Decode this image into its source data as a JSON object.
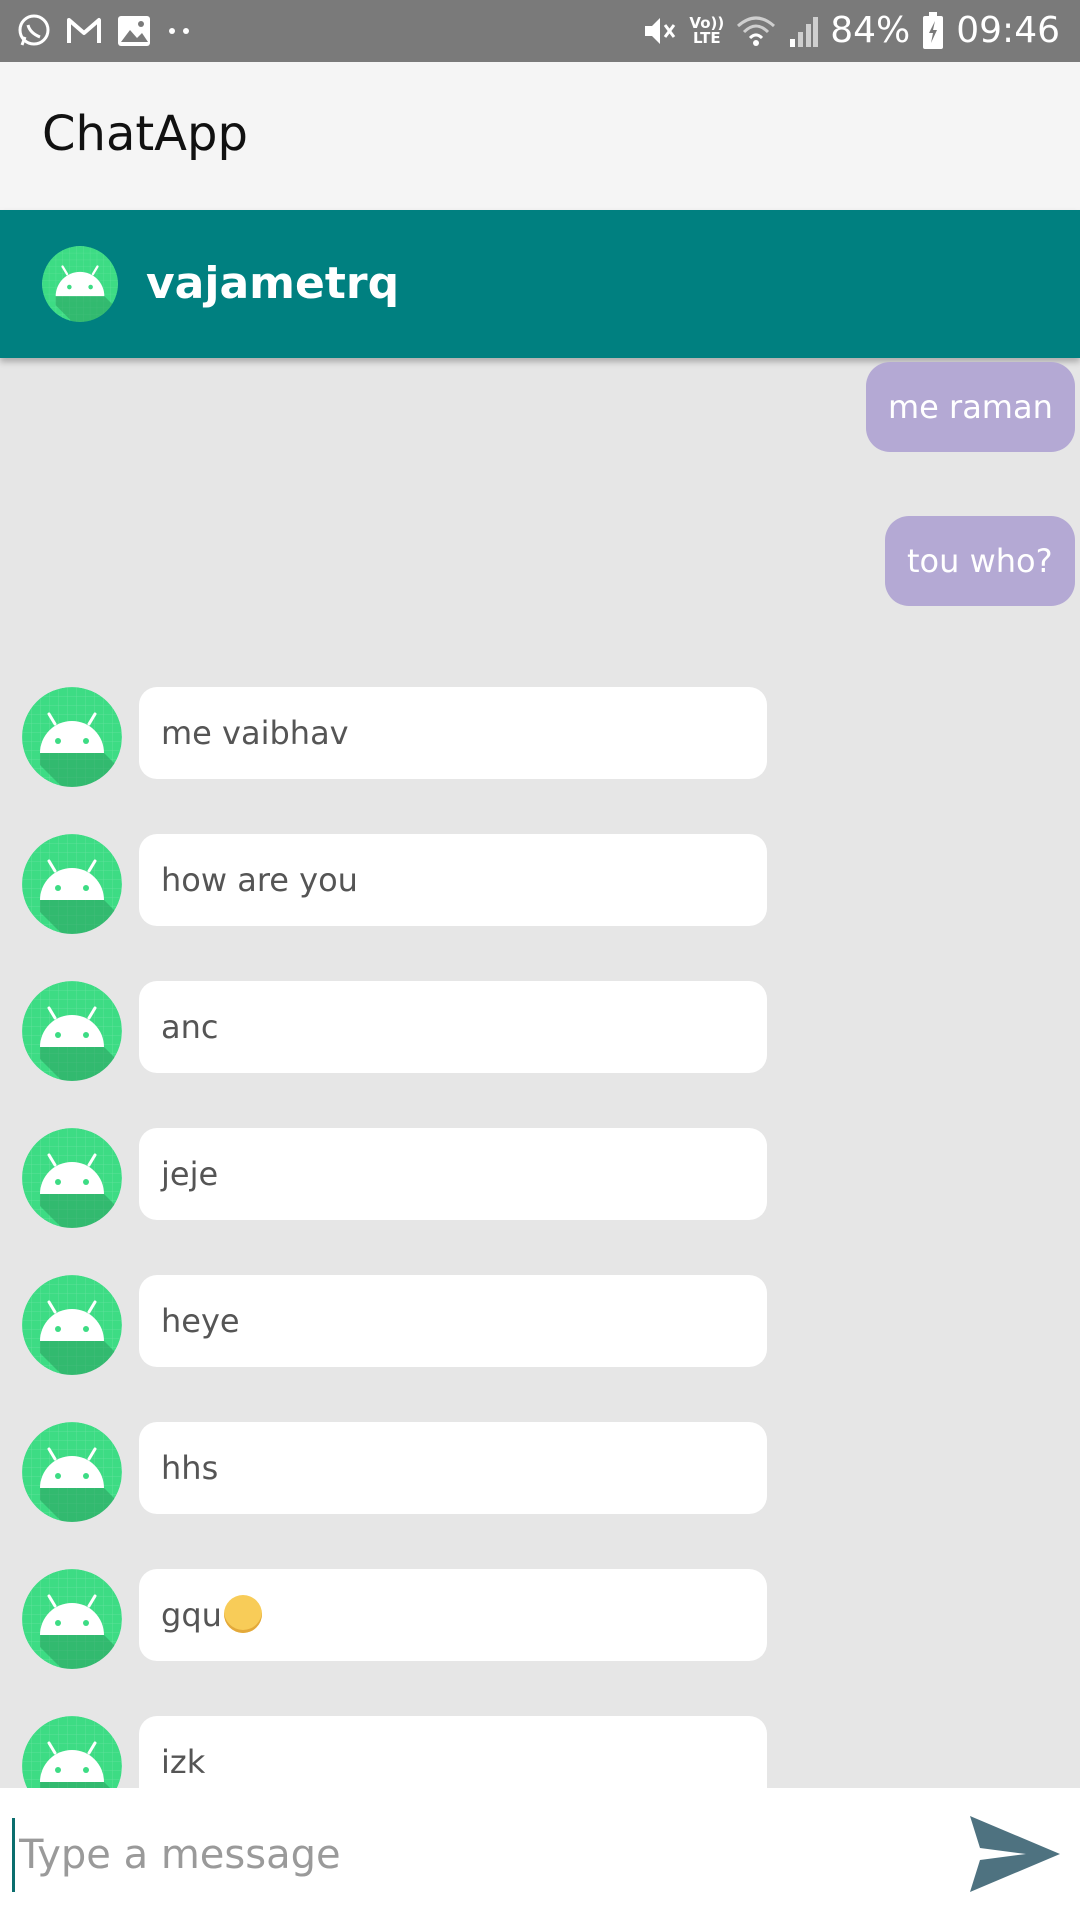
{
  "status_bar": {
    "icons_left": [
      "whatsapp-icon",
      "gmail-icon",
      "gallery-icon",
      "more-dots-icon"
    ],
    "icons_right": [
      "mute-icon",
      "volte-icon",
      "wifi-icon",
      "signal-icon",
      "battery-icon"
    ],
    "volte_top": "Vo))",
    "volte_bottom": "LTE",
    "battery": "84%",
    "time": "09:46"
  },
  "app_bar": {
    "title": "ChatApp"
  },
  "chat_header": {
    "name": "vajametrq",
    "avatar_icon": "android-avatar-icon"
  },
  "messages": {
    "outgoing": [
      {
        "text": "me raman"
      },
      {
        "text": "tou who?"
      }
    ],
    "incoming": [
      {
        "text": "me vaibhav"
      },
      {
        "text": "how are you"
      },
      {
        "text": "anc"
      },
      {
        "text": "jeje"
      },
      {
        "text": "heye"
      },
      {
        "text": "hhs"
      },
      {
        "text": "gqu",
        "emoji": "grinning-sweat-emoji"
      },
      {
        "text": "izk"
      }
    ]
  },
  "input_bar": {
    "placeholder": "Type a message",
    "value": "",
    "send_icon": "send-icon"
  },
  "colors": {
    "header": "#008080",
    "app_bar": "#f5f5f5",
    "outgoing_bubble": "#b4a9d4",
    "incoming_bubble": "#ffffff",
    "avatar": "#3ddc84",
    "send": "#4e7280",
    "background": "#e6e6e6"
  }
}
